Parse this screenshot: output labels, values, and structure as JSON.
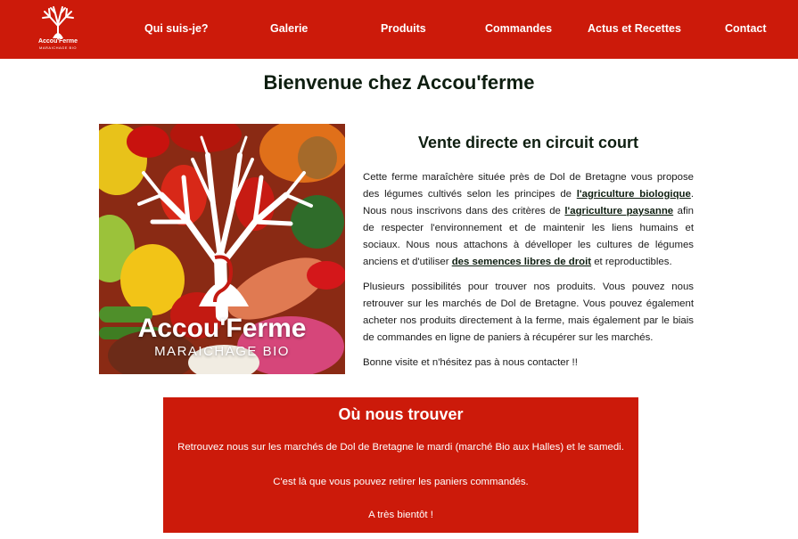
{
  "header": {
    "logo": {
      "name": "Accou'Ferme",
      "sub": "MARAICHAGE BIO",
      "icon": "tree-ear-logo-icon"
    },
    "nav": [
      {
        "label": "Qui suis-je?"
      },
      {
        "label": "Galerie"
      },
      {
        "label": "Produits"
      },
      {
        "label": "Commandes"
      },
      {
        "label": "Actus et Recettes"
      },
      {
        "label": "Contact"
      }
    ]
  },
  "main": {
    "title": "Bienvenue chez Accou'ferme",
    "hero_image": {
      "brand": "Accou'Ferme",
      "sub": "MARAICHAGE BIO",
      "icon": "tree-ear-logo-icon"
    },
    "intro": {
      "heading": "Vente directe en circuit court",
      "p1": {
        "t1": "Cette ferme maraîchère située près de Dol de Bretagne vous propose des légumes cultivés selon les principes de ",
        "link1": "l'agriculture biologique",
        "t2": ". Nous nous inscrivons dans des critères de ",
        "link2": "l'agriculture paysanne",
        "t3": " afin de respecter l'environnement et de maintenir les liens humains et sociaux. Nous nous attachons à dévelloper les cultures de légumes anciens et d'utiliser ",
        "link3": "des semences libres de droit",
        "t4": " et reproductibles."
      },
      "p2": "Plusieurs possibilités pour trouver nos produits. Vous pouvez nous retrouver sur les marchés de Dol de Bretagne. Vous pouvez également acheter nos produits directement à la ferme, mais également par le biais de commandes en ligne de paniers à récupérer sur les marchés.",
      "p3": "Bonne visite et n'hésitez pas à nous contacter !!"
    },
    "find_us": {
      "title": "Où nous trouver",
      "line1": "Retrouvez nous sur les marchés de Dol de Bretagne le mardi (marché Bio aux Halles) et le samedi.",
      "line2": "C'est là que vous pouvez retirer les paniers commandés.",
      "line3": "A très bientôt !"
    }
  },
  "colors": {
    "brand_red": "#cc1a0a",
    "heading_dark": "#0e1e10",
    "white": "#ffffff"
  }
}
